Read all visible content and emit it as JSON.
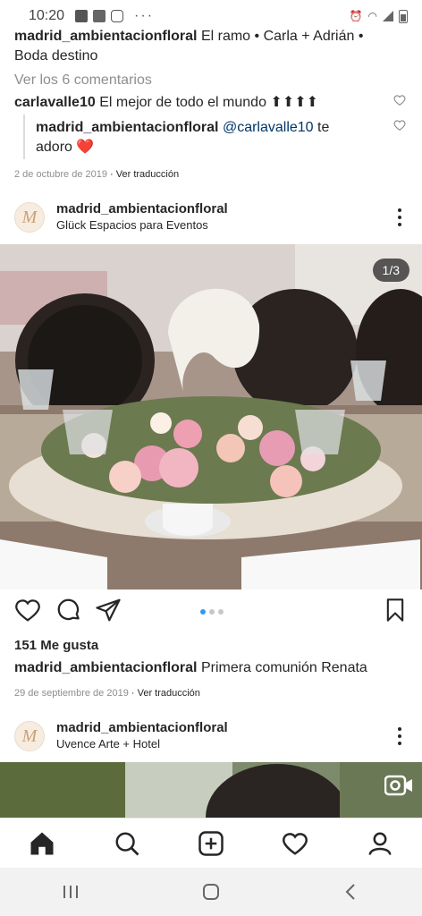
{
  "status_bar": {
    "time": "10:20",
    "dots": "···"
  },
  "prev_post": {
    "caption_user": "madrid_ambientacionfloral",
    "caption_text": " El ramo • Carla + Adrián • Boda destino",
    "view_comments": "Ver los 6 comentarios",
    "comment1_user": "carlavalle10",
    "comment1_text": " El mejor de todo el mundo ⬆⬆⬆⬆",
    "reply_user": "madrid_ambientacionfloral",
    "reply_mention": " @carlavalle10",
    "reply_text": " te adoro ❤️",
    "date": "2 de octubre de 2019",
    "translate": " · Ver traducción"
  },
  "post1": {
    "username": "madrid_ambientacionfloral",
    "location": "Glück Espacios para Eventos",
    "counter": "1/3",
    "likes": "151 Me gusta",
    "caption_user": "madrid_ambientacionfloral",
    "caption_text": " Primera comunión Renata",
    "date": "29 de septiembre de 2019",
    "translate": " · Ver traducción",
    "carousel": {
      "current": 1,
      "total": 3
    }
  },
  "post2": {
    "username": "madrid_ambientacionfloral",
    "location": "Uvence Arte + Hotel"
  },
  "avatar_letter": "M",
  "colors": {
    "accent": "#3897f0",
    "heart": "#ed4956",
    "text": "#262626",
    "muted": "#8e8e8e"
  },
  "tabs": [
    "home-icon",
    "search-icon",
    "add-icon",
    "activity-icon",
    "profile-icon"
  ]
}
